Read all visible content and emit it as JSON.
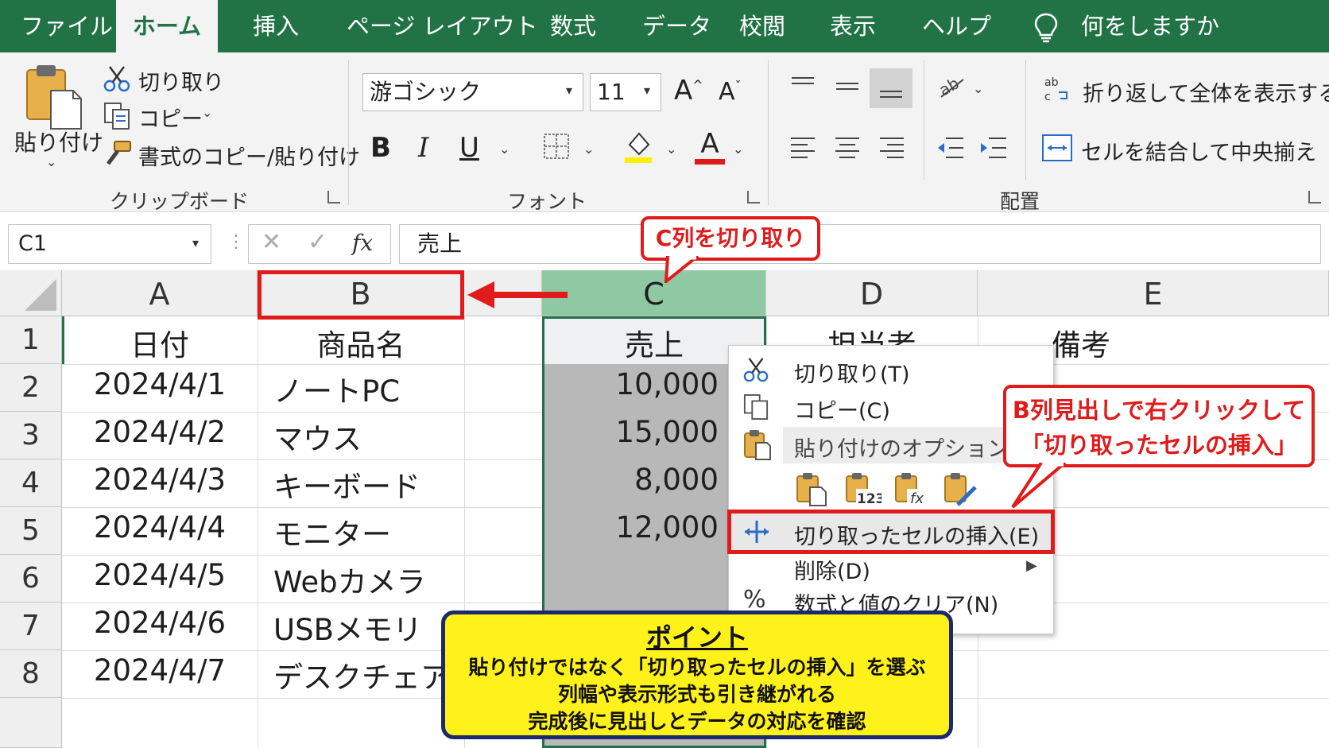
{
  "tabs": [
    "ファイル",
    "ホーム",
    "挿入",
    "ページ レイアウト",
    "数式",
    "データ",
    "校閲",
    "表示",
    "ヘルプ"
  ],
  "tell_me": "何をしますか",
  "clipboard": {
    "paste": "貼り付け",
    "cut": "切り取り",
    "copy": "コピー",
    "format_painter": "書式のコピー/貼り付け",
    "group": "クリップボード"
  },
  "font": {
    "name": "游ゴシック",
    "size": "11",
    "bold": "B",
    "italic": "I",
    "underline": "U",
    "group": "フォント"
  },
  "alignment": {
    "wrap_text": "折り返して全体を表示する",
    "merge_center": "セルを結合して中央揃え",
    "group": "配置"
  },
  "formula_bar": {
    "name_box": "C1",
    "fx": "fx",
    "content": "売上"
  },
  "columns": [
    "A",
    "B",
    "C",
    "D",
    "E"
  ],
  "rows": [
    "1",
    "2",
    "3",
    "4",
    "5",
    "6",
    "7",
    "8"
  ],
  "cells": {
    "header": [
      "日付",
      "商品名",
      "売上",
      "担当者",
      "備考"
    ],
    "dates": [
      "2024/4/1",
      "2024/4/2",
      "2024/4/3",
      "2024/4/4",
      "2024/4/5",
      "2024/4/6",
      "2024/4/7"
    ],
    "products": [
      "ノートPC",
      "マウス",
      "キーボード",
      "モニター",
      "Webカメラ",
      "USBメモリ",
      "デスクチェア"
    ],
    "sales": [
      "10,000",
      "15,000",
      "8,000",
      "12,000"
    ]
  },
  "context_menu": {
    "cut": "切り取り(T)",
    "copy": "コピー(C)",
    "paste_options": "貼り付けのオプション:",
    "insert_cut_cells": "切り取ったセルの挿入(E)",
    "delete": "削除(D)",
    "clear_contents": "数式と値のクリア(N)"
  },
  "callouts": {
    "cut_column": "C列を切り取り",
    "right_click_line1": "B列見出しで右クリックして",
    "right_click_line2": "「切り取ったセルの挿入」",
    "point_title": "ポイント",
    "point_line1": "貼り付けではなく「切り取ったセルの挿入」を選ぶ",
    "point_line2": "列幅や表示形式も引き継がれる",
    "point_line3": "完成後に見出しとデータの対応を確認"
  },
  "colors": {
    "excel_green": "#217346",
    "highlight_red": "#e01b1b",
    "point_yellow": "#fff21a",
    "point_border": "#1a2a6b",
    "selected_header": "#8fc9a4"
  }
}
